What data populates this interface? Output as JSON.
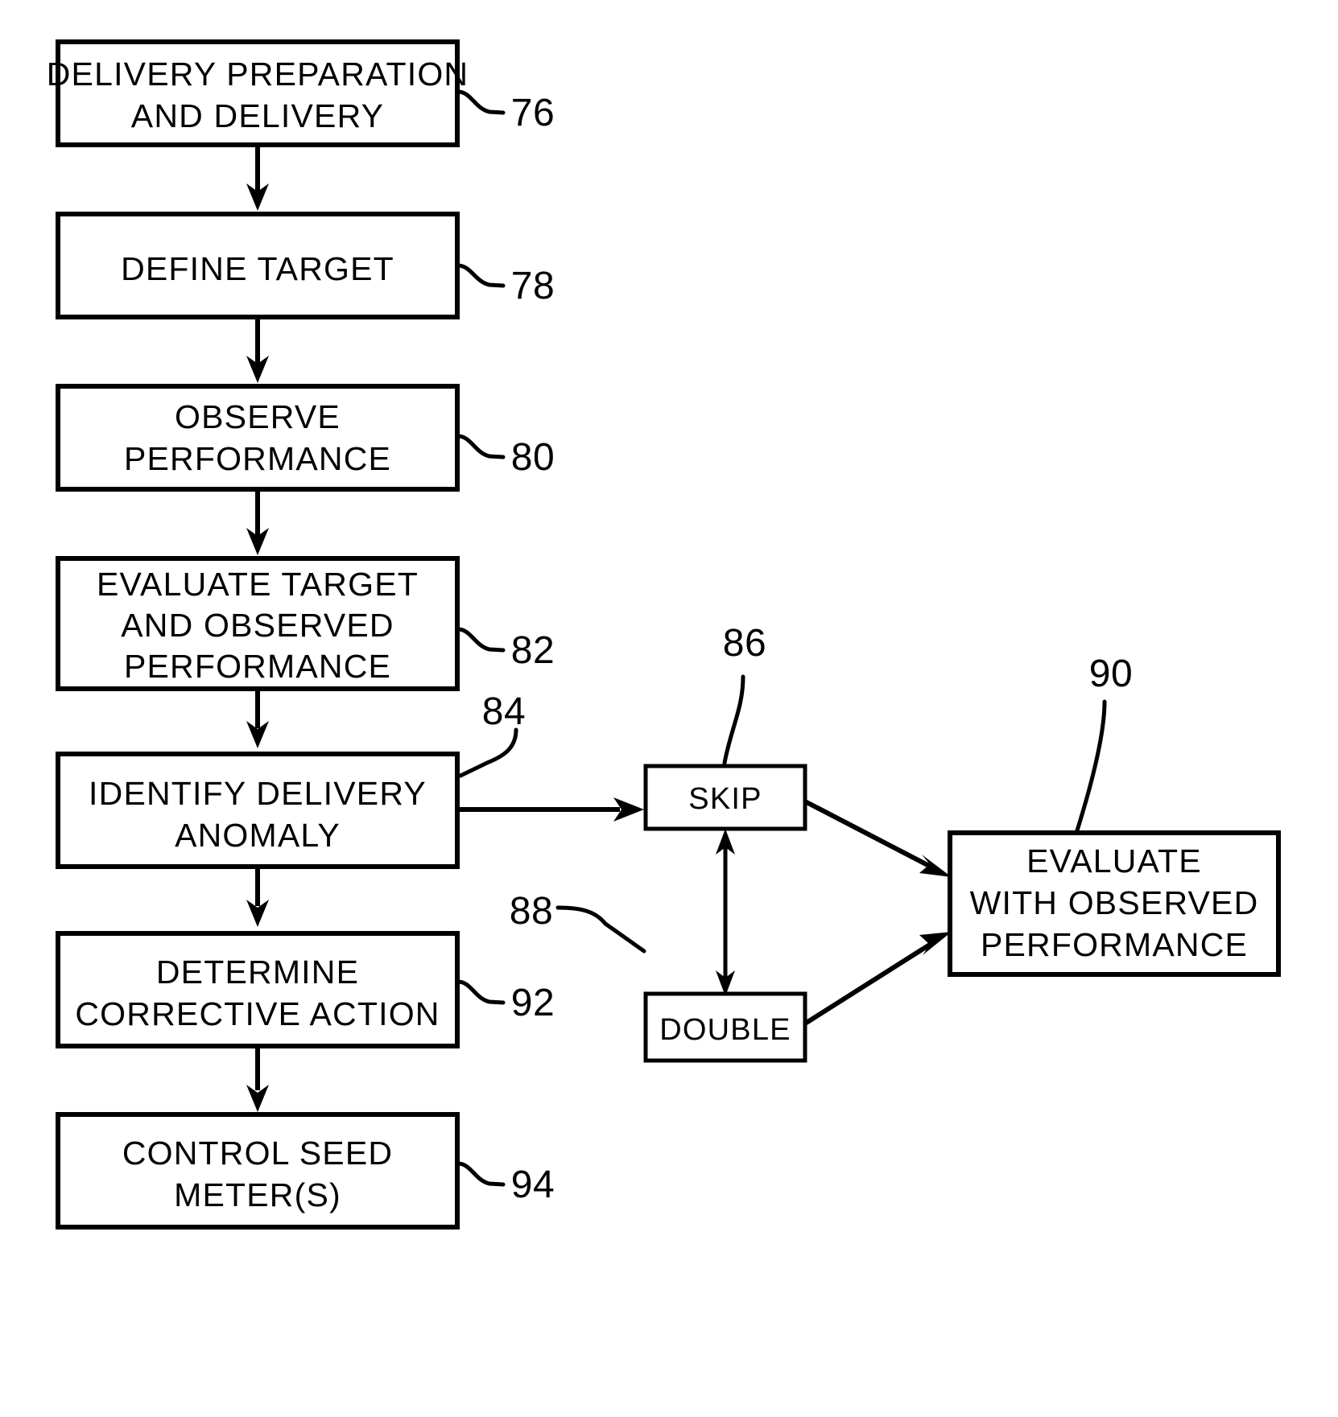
{
  "figure": {
    "type": "patent-flowchart",
    "background": "#ffffff",
    "ink": "#000000"
  },
  "boxes": [
    {
      "id": "delivery-preparation",
      "ref": "76",
      "lines": [
        "DELIVERY  PREPARATION",
        "AND  DELIVERY"
      ]
    },
    {
      "id": "define-target",
      "ref": "78",
      "lines": [
        "DEFINE  TARGET"
      ]
    },
    {
      "id": "observe-performance",
      "ref": "80",
      "lines": [
        "OBSERVE",
        "PERFORMANCE"
      ]
    },
    {
      "id": "evaluate-target-and-observed-performance",
      "ref": "82",
      "lines": [
        "EVALUATE  TARGET",
        "AND  OBSERVED",
        "PERFORMANCE"
      ]
    },
    {
      "id": "identify-delivery-anomaly",
      "ref": "84",
      "lines": [
        "IDENTIFY  DELIVERY",
        "ANOMALY"
      ]
    },
    {
      "id": "skip",
      "ref": "86",
      "lines": [
        "SKIP"
      ]
    },
    {
      "id": "double",
      "ref": "88",
      "lines": [
        "DOUBLE"
      ]
    },
    {
      "id": "evaluate-with-observed-performance",
      "ref": "90",
      "lines": [
        "EVALUATE",
        "WITH  OBSERVED",
        "PERFORMANCE"
      ]
    },
    {
      "id": "determine-corrective-action",
      "ref": "92",
      "lines": [
        "DETERMINE",
        "CORRECTIVE  ACTION"
      ]
    },
    {
      "id": "control-seed-meters",
      "ref": "94",
      "lines": [
        "CONTROL SEED",
        "METER(S)"
      ]
    }
  ],
  "labels": {
    "b76_l1": "DELIVERY  PREPARATION",
    "b76_l2": "AND  DELIVERY",
    "b78_l1": "DEFINE  TARGET",
    "b80_l1": "OBSERVE",
    "b80_l2": "PERFORMANCE",
    "b82_l1": "EVALUATE  TARGET",
    "b82_l2": "AND  OBSERVED",
    "b82_l3": "PERFORMANCE",
    "b84_l1": "IDENTIFY  DELIVERY",
    "b84_l2": "ANOMALY",
    "b86_l1": "SKIP",
    "b88_l1": "DOUBLE",
    "b90_l1": "EVALUATE",
    "b90_l2": "WITH  OBSERVED",
    "b90_l3": "PERFORMANCE",
    "b92_l1": "DETERMINE",
    "b92_l2": "CORRECTIVE  ACTION",
    "b94_l1": "CONTROL SEED",
    "b94_l2": "METER(S)"
  },
  "refs": {
    "r76": "76",
    "r78": "78",
    "r80": "80",
    "r82": "82",
    "r84": "84",
    "r86": "86",
    "r88": "88",
    "r90": "90",
    "r92": "92",
    "r94": "94"
  }
}
